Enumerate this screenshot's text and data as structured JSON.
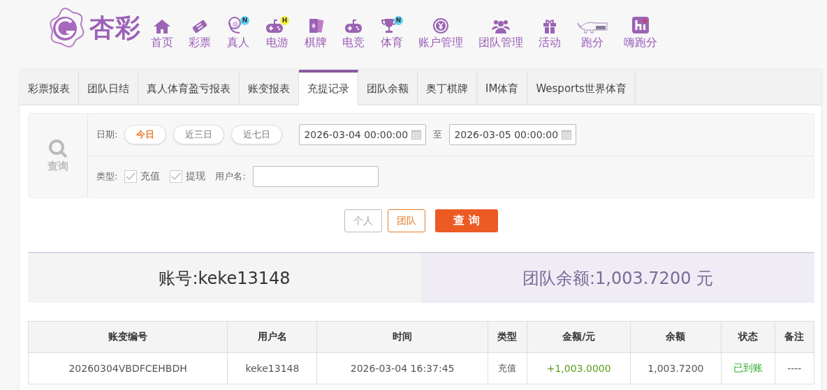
{
  "header": {
    "logo_text": "杏彩",
    "nav": [
      {
        "label": "首页"
      },
      {
        "label": "彩票"
      },
      {
        "label": "真人",
        "badge": {
          "text": "N",
          "color": "#5fd3f3"
        }
      },
      {
        "label": "电游",
        "badge": {
          "text": "H",
          "color": "#f7f03c"
        }
      },
      {
        "label": "棋牌"
      },
      {
        "label": "电竞"
      },
      {
        "label": "体育",
        "badge": {
          "text": "N",
          "color": "#5fd3f3"
        }
      },
      {
        "label": "账户管理"
      },
      {
        "label": "团队管理"
      },
      {
        "label": "活动"
      },
      {
        "label": "跑分"
      },
      {
        "label": "嗨跑分"
      }
    ]
  },
  "tabs": [
    {
      "label": "彩票报表",
      "selected": false
    },
    {
      "label": "团队日结",
      "selected": false
    },
    {
      "label": "真人体育盈亏报表",
      "selected": false
    },
    {
      "label": "账变报表",
      "selected": false
    },
    {
      "label": "充提记录",
      "selected": true
    },
    {
      "label": "团队余额",
      "selected": false
    },
    {
      "label": "奥丁棋牌",
      "selected": false
    },
    {
      "label": "IM体育",
      "selected": false
    },
    {
      "label": "Wesports世界体育",
      "selected": false
    }
  ],
  "filter": {
    "search_label": "查询",
    "date_label": "日期:",
    "quick_dates": [
      {
        "label": "今日",
        "selected": true
      },
      {
        "label": "近三日",
        "selected": false
      },
      {
        "label": "近七日",
        "selected": false
      }
    ],
    "start": "2026-03-04 00:00:00",
    "to_label": "至",
    "end": "2026-03-05 00:00:00",
    "type_label": "类型:",
    "types": [
      {
        "label": "充值",
        "checked": true
      },
      {
        "label": "提现",
        "checked": true
      }
    ],
    "username_label": "用户名:"
  },
  "scope_buttons": [
    {
      "label": "个人",
      "selected": false
    },
    {
      "label": "团队",
      "selected": true
    }
  ],
  "query_button": "查 询",
  "summary": {
    "account": "账号:keke13148",
    "balance": "团队余额:1,003.7200 元"
  },
  "table": {
    "columns": [
      "账变编号",
      "用户名",
      "时间",
      "类型",
      "金额/元",
      "余额",
      "状态",
      "备注"
    ],
    "rows": [
      {
        "cells": [
          "20260304VBDFCEHBDH",
          "keke13148",
          "2026-03-04 16:37:45",
          "充值",
          "+1,003.0000",
          "1,003.7200",
          "已到账",
          "----"
        ]
      }
    ]
  }
}
